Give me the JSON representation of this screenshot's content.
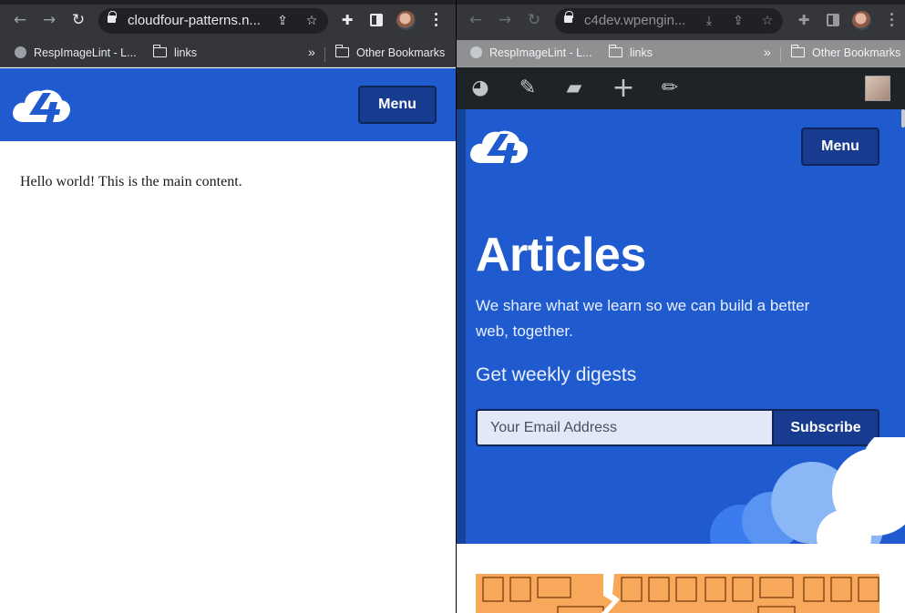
{
  "left_window": {
    "url": "cloudfour-patterns.n...",
    "bookmarks": [
      "RespImageLint - L...",
      "links",
      "»",
      "Other Bookmarks"
    ],
    "menu_label": "Menu",
    "main_text": "Hello world! This is the main content."
  },
  "right_window": {
    "url": "c4dev.wpengin...",
    "bookmarks": [
      "RespImageLint - L...",
      "links",
      "»",
      "Other Bookmarks"
    ],
    "admin_icons": [
      "palette-icon",
      "brush-icon",
      "comment-icon",
      "plus-icon",
      "pencil-icon"
    ],
    "menu_label": "Menu",
    "title": "Articles",
    "subtitle": "We share what we learn so we can build a better web, together.",
    "digest_heading": "Get weekly digests",
    "email_placeholder": "Your Email Address",
    "subscribe_label": "Subscribe"
  },
  "colors": {
    "brand_blue": "#1f5bcf",
    "button_dark_blue": "#173b8f",
    "chrome_dark": "#35363a",
    "wp_admin_bar": "#1d2327",
    "pattern_orange": "#f7a85a"
  }
}
